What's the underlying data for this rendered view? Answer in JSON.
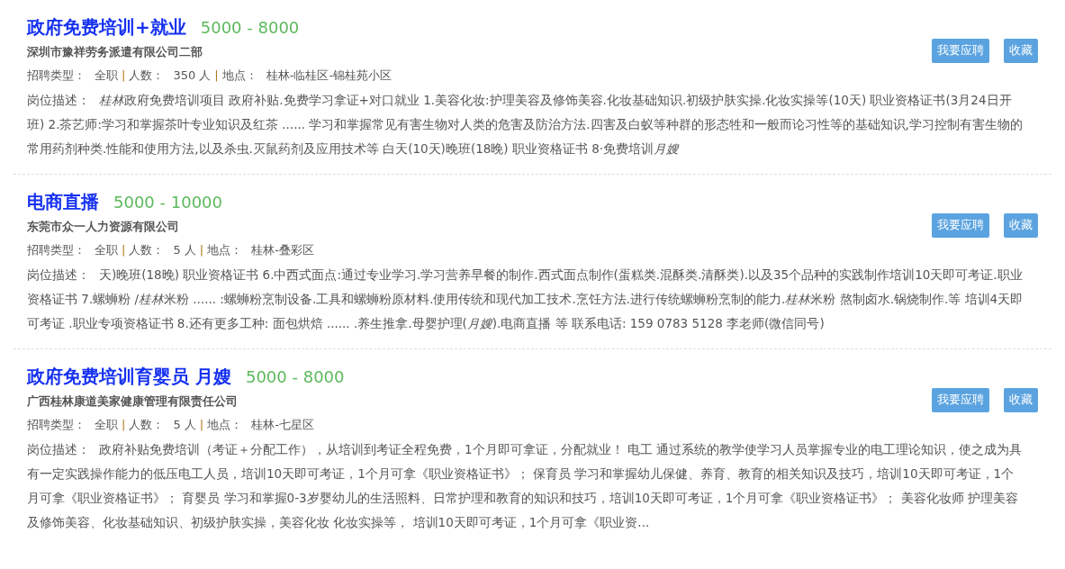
{
  "jobs": [
    {
      "title": "政府免费培训+就业",
      "salary": "5000 - 8000",
      "company": "深圳市豫祥劳务派遣有限公司二部",
      "meta": [
        {
          "label": "招聘类型：",
          "value": "全职",
          "separator": "|"
        },
        {
          "label": "人数：",
          "value": "350 人",
          "separator": "|"
        },
        {
          "label": "地点：",
          "value": "桂林-临桂区-锦桂苑小区"
        }
      ],
      "description_label": "岗位描述：",
      "description": [
        {
          "text": "桂林",
          "italic": true
        },
        {
          "text": "政府免费培训项目 政府补贴.免费学习拿证+对口就业 1.美容化妆:护理美容及修饰美容.化妆基础知识.初级护肤实操.化妆实操等(10天) 职业资格证书(3月24日开班) 2.茶艺师:学习和掌握茶叶专业知识及红茶 ...... 学习和掌握常见有害生物对人类的危害及防治方法.四害及白蚁等种群的形态牲和一般而论习性等的基础知识,学习控制有害生物的常用药剂种类.性能和使用方法,以及杀虫.灭鼠药剂及应用技术等 白天(10天)晚班(18晚) 职业资格证书 8·免费培训",
          "italic": false
        },
        {
          "text": "月嫂",
          "italic": true
        }
      ],
      "buttons": [
        "我要应聘",
        "收藏"
      ]
    },
    {
      "title": "电商直播",
      "salary": "5000 - 10000",
      "company": "东莞市众一人力资源有限公司",
      "meta": [
        {
          "label": "招聘类型：",
          "value": "全职",
          "separator": "|"
        },
        {
          "label": "人数：",
          "value": "5 人",
          "separator": "|"
        },
        {
          "label": "地点：",
          "value": "桂林-叠彩区"
        }
      ],
      "description_label": "岗位描述：",
      "description": [
        {
          "text": "天)晚班(18晚) 职业资格证书 6.中西式面点:通过专业学习.学习营养早餐的制作.西式面点制作(蛋糕类.混酥类.清酥类).以及35个品种的实践制作培训10天即可考证.职业资格证书 7.螺蛳粉 /",
          "italic": false
        },
        {
          "text": "桂林",
          "italic": true
        },
        {
          "text": "米粉 ...... :螺蛳粉烹制设备.工具和螺蛳粉原材料.使用传统和现代加工技术.烹饪方法.进行传统螺蛳粉烹制的能力.",
          "italic": false
        },
        {
          "text": "桂林",
          "italic": true
        },
        {
          "text": "米粉 熬制卤水.锅烧制作.等 培训4天即可考证 .职业专项资格证书 8.还有更多工种: 面包烘焙 ...... .养生推拿.母婴护理(",
          "italic": false
        },
        {
          "text": "月嫂",
          "italic": true
        },
        {
          "text": ").电商直播 等 联系电话: 159 0783 5128 李老师(微信同号)",
          "italic": false
        }
      ],
      "buttons": [
        "我要应聘",
        "收藏"
      ]
    },
    {
      "title": "政府免费培训育婴员 月嫂",
      "salary": "5000 - 8000",
      "company": "广西桂林康道美家健康管理有限责任公司",
      "meta": [
        {
          "label": "招聘类型：",
          "value": "全职",
          "separator": "|"
        },
        {
          "label": "人数：",
          "value": "5 人",
          "separator": "|"
        },
        {
          "label": "地点：",
          "value": "桂林-七星区"
        }
      ],
      "description_label": "岗位描述：",
      "description": [
        {
          "italic": false,
          "text": "政府补贴免费培训（考证＋分配工作），从培训到考证全程免费，1个月即可拿证，分配就业！ 电工 通过系统的教学使学习人员掌握专业的电工理论知识，使之成为具有一定实践操作能力的低压电工人员，培训10天即可考证，1个月可拿《职业资格证书》； 保育员 学习和掌握幼儿保健、养育、教育的相关知识及技巧，培训10天即可考证，1个月可拿《职业资格证书》； 育婴员 学习和掌握0-3岁婴幼儿的生活照料、日常护理和教育的知识和技巧，培训10天即可考证，1个月可拿《职业资格证书》； 美容化妆师 护理美容及修饰美容、化妆基础知识、初级护肤实操，美容化妆 化妆实操等， 培训10天即可考证，1个月可拿《职业资..."
        }
      ],
      "buttons": [
        "我要应聘",
        "收藏"
      ]
    }
  ]
}
